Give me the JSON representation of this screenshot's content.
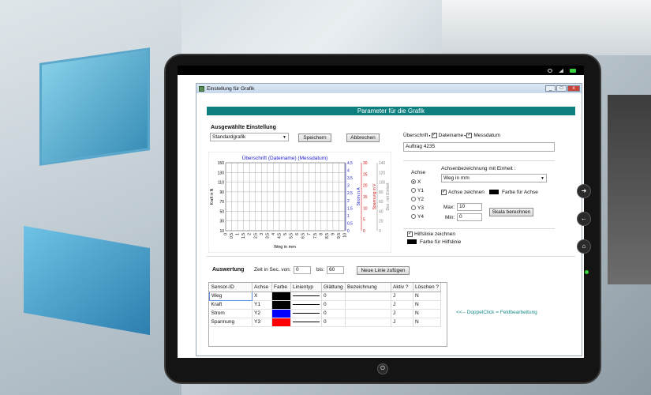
{
  "window": {
    "title": "Einstellung für Grafik",
    "btn_min": "_",
    "btn_max": "□",
    "btn_close": "x"
  },
  "banner": "Parameter für die Grafik",
  "setting": {
    "heading": "Ausgewählte Einstellung",
    "selected": "Standardgrafik",
    "save_label": "Speichern",
    "cancel_label": "Abbrechen"
  },
  "header_opts": {
    "ueberschrift_label": "Überschrift",
    "dateiname_label": "Dateiname",
    "messdatum_label": "Messdatum",
    "dateiname_checked": true,
    "messdatum_checked": true,
    "title_value": "Auftrag 4235"
  },
  "axis": {
    "group_label": "Achse",
    "options": [
      "X",
      "Y1",
      "Y2",
      "Y3",
      "Y4"
    ],
    "selected": "X",
    "desc_label": "Achsenbezeichnung mit Einheit :",
    "desc_value": "Weg in mm",
    "draw_label": "Achse zeichnen",
    "color_label": "Farbe für Achse",
    "max_label": "Max:",
    "max_value": "10",
    "min_label": "Min:",
    "min_value": "0",
    "scale_button": "Skala berechnen"
  },
  "helpline": {
    "label": "Hilfslinie zeichnen",
    "color_label": "Farbe für Hilfslinie"
  },
  "eval": {
    "heading": "Auswertung",
    "time_label": "Zeit in Sec. von:",
    "from_value": "0",
    "to_label": "bis:",
    "to_value": "60",
    "add_line_button": "Neue Linie zufügen",
    "hint": "<<-- DoppelClick = Feldbearbeitung"
  },
  "table": {
    "headers": [
      "Sensor-ID",
      "Achse",
      "Farbe",
      "Linientyp",
      "Glättung",
      "Bezeichnung",
      "Aktiv ?",
      "Löschen ?"
    ],
    "rows": [
      {
        "id": "Weg",
        "axis": "X",
        "color": "#000000",
        "smooth": "0",
        "active": "J",
        "delete": "N"
      },
      {
        "id": "Kraft",
        "axis": "Y1",
        "color": "#000000",
        "smooth": "0",
        "active": "J",
        "delete": "N"
      },
      {
        "id": "Strom",
        "axis": "Y2",
        "color": "#0000ff",
        "smooth": "0",
        "active": "J",
        "delete": "N"
      },
      {
        "id": "Spannung",
        "axis": "Y3",
        "color": "#ff0000",
        "smooth": "0",
        "active": "J",
        "delete": "N"
      }
    ]
  },
  "chart_data": {
    "type": "line",
    "title": "Überschrift (Dateiname) (Messdatum)",
    "xlabel": "Weg in mm",
    "x_ticks": [
      "0",
      "0,5",
      "1",
      "1,5",
      "2",
      "2,5",
      "3",
      "3,5",
      "4",
      "4,5",
      "5",
      "5,5",
      "6",
      "6,5",
      "7",
      "7,5",
      "8",
      "8,5",
      "9",
      "9,5",
      "10"
    ],
    "xlim": [
      0,
      10
    ],
    "grid": true,
    "axes": [
      {
        "name": "Kraft in N",
        "color": "#000000",
        "ticks": [
          "150",
          "130",
          "110",
          "90",
          "70",
          "50",
          "30",
          "10"
        ],
        "ylim": [
          10,
          150
        ]
      },
      {
        "name": "Strom in A",
        "color": "#1a1acc",
        "ticks": [
          "4,5",
          "4",
          "3,5",
          "3",
          "2,5",
          "2",
          "1,5",
          "1",
          "0,5",
          "0"
        ],
        "ylim": [
          0,
          4.5
        ]
      },
      {
        "name": "Spannung in V",
        "color": "#cc1111",
        "ticks": [
          "30",
          "25",
          "20",
          "15",
          "10",
          "5",
          "0"
        ],
        "ylim": [
          0,
          30
        ]
      },
      {
        "name": "Dez. mit Einheit",
        "color": "#888888",
        "ticks": [
          "140",
          "120",
          "100",
          "80",
          "60",
          "40",
          "20",
          "0"
        ],
        "ylim": [
          0,
          140
        ]
      }
    ]
  }
}
